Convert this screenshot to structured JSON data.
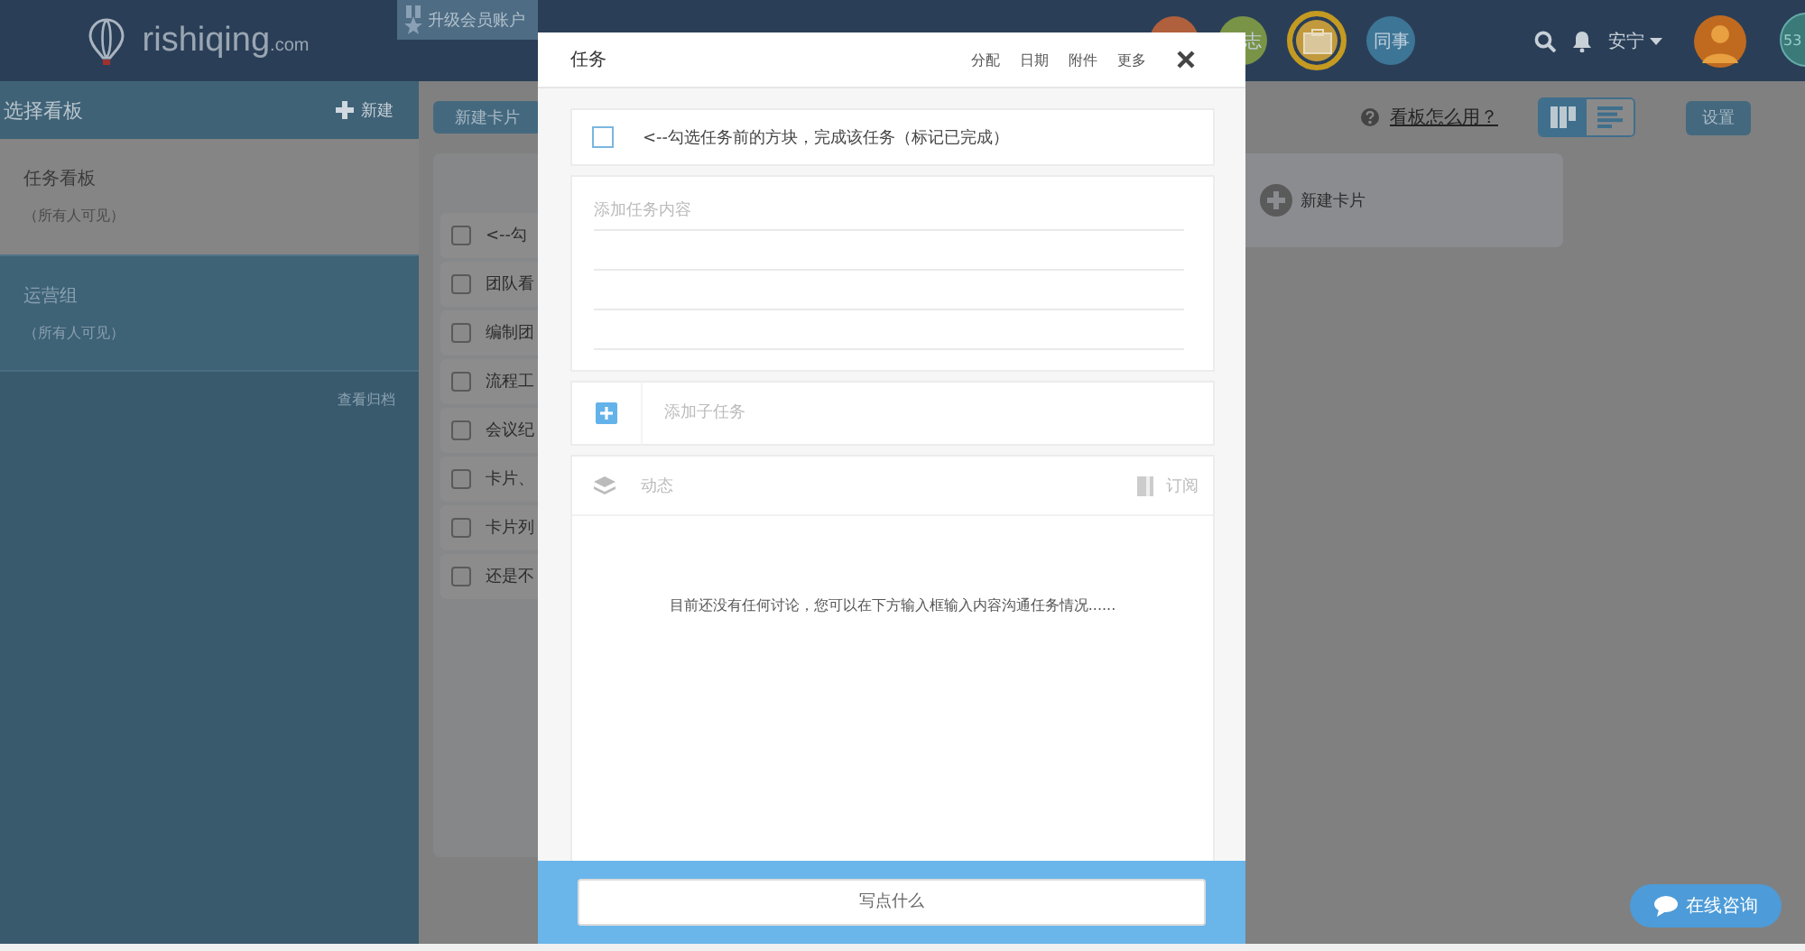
{
  "header": {
    "logo": "rishiqing",
    "logo_suffix": ".com",
    "upgrade": "升级会员账户",
    "circles": [
      {
        "kind": "blank",
        "color": "#b0603c",
        "selected": false
      },
      {
        "kind": "text",
        "label": "志",
        "color": "#7a9447",
        "selected": false
      },
      {
        "kind": "icon",
        "color": "#c29a3c",
        "selected": true
      },
      {
        "kind": "text",
        "label": "同事",
        "color": "#3d7596",
        "selected": false
      }
    ],
    "user": "安宁",
    "badge": "53"
  },
  "sidebar": {
    "title": "选择看板",
    "new": "新建",
    "boards": [
      {
        "name": "任务看板",
        "visibility": "（所有人可见）",
        "selected": true
      },
      {
        "name": "运营组",
        "visibility": "（所有人可见）",
        "selected": false
      }
    ],
    "archive": "查看归档"
  },
  "toolbar": {
    "new_card": "新建卡片",
    "help": "看板怎么用？",
    "views": [
      {
        "kind": "board",
        "selected": true
      },
      {
        "kind": "list",
        "selected": false
      }
    ],
    "settings": "设置"
  },
  "list_cards": [
    {
      "text": "<--勾",
      "checked": false
    },
    {
      "text": "团队看",
      "checked": false
    },
    {
      "text": "编制团",
      "checked": false
    },
    {
      "text": "流程工",
      "checked": false
    },
    {
      "text": "会议纪",
      "checked": false
    },
    {
      "text": "卡片、",
      "checked": false
    },
    {
      "text": "卡片列",
      "checked": false
    },
    {
      "text": "还是不",
      "checked": false
    }
  ],
  "add_card": "新建卡片",
  "modal": {
    "title": "任务",
    "actions": [
      "分配",
      "日期",
      "附件",
      "更多"
    ],
    "complete": {
      "label": "<--勾选任务前的方块，完成该任务（标记已完成）",
      "checked": false
    },
    "content_placeholder": "添加任务内容",
    "subtask_placeholder": "添加子任务",
    "activity": "动态",
    "subscribe": "订阅",
    "empty": "目前还没有任何讨论，您可以在下方输入框输入内容沟通任务情况......",
    "comment_placeholder": "写点什么"
  },
  "chat": "在线咨询"
}
